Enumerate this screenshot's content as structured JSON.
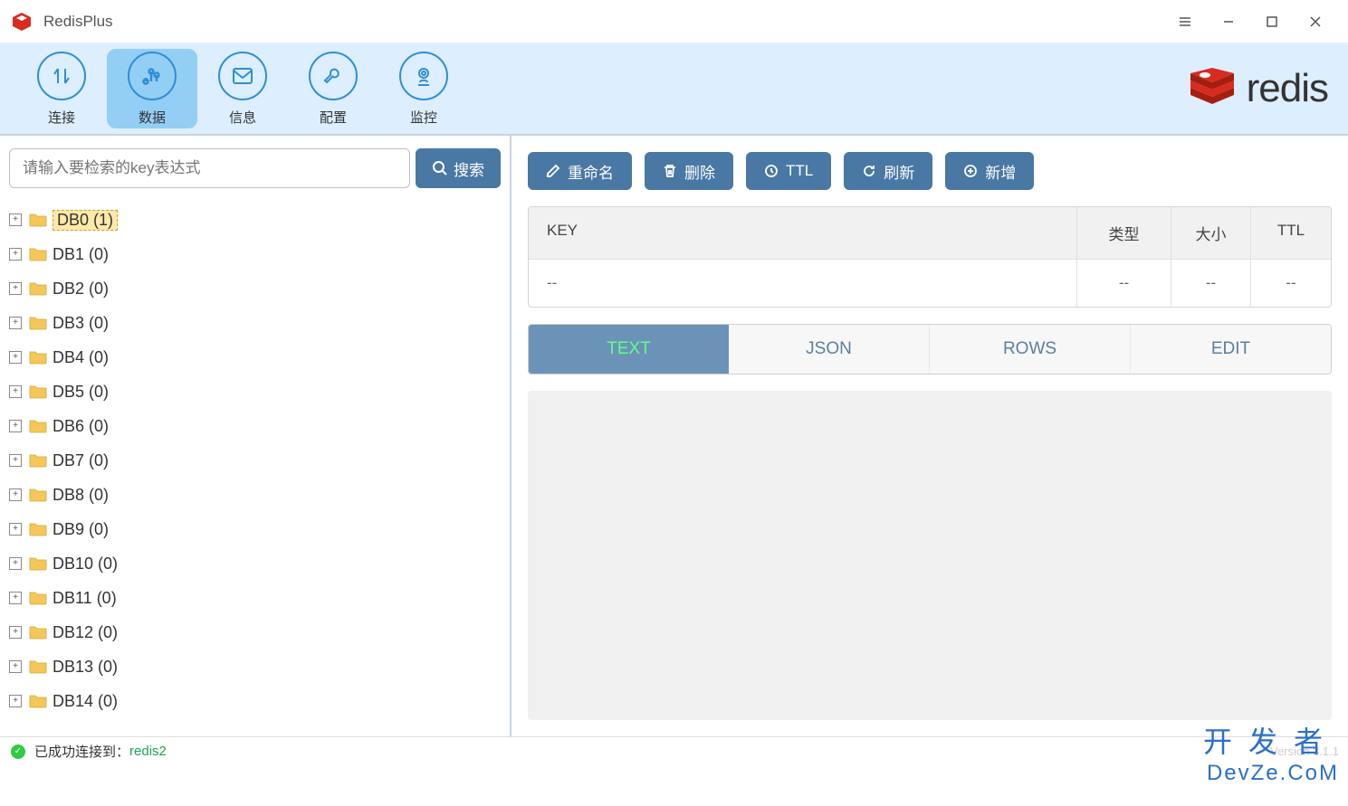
{
  "titlebar": {
    "app_name": "RedisPlus"
  },
  "toolbar": {
    "items": [
      {
        "label": "连接",
        "icon": "arrows"
      },
      {
        "label": "数据",
        "icon": "chart"
      },
      {
        "label": "信息",
        "icon": "mail"
      },
      {
        "label": "配置",
        "icon": "wrench"
      },
      {
        "label": "监控",
        "icon": "camera"
      }
    ],
    "active_index": 1,
    "logo_text": "redis"
  },
  "search": {
    "placeholder": "请输入要检索的key表达式",
    "button": "搜索"
  },
  "tree": {
    "items": [
      {
        "label": "DB0 (1)",
        "selected": true
      },
      {
        "label": "DB1 (0)"
      },
      {
        "label": "DB2 (0)"
      },
      {
        "label": "DB3 (0)"
      },
      {
        "label": "DB4 (0)"
      },
      {
        "label": "DB5 (0)"
      },
      {
        "label": "DB6 (0)"
      },
      {
        "label": "DB7 (0)"
      },
      {
        "label": "DB8 (0)"
      },
      {
        "label": "DB9 (0)"
      },
      {
        "label": "DB10 (0)"
      },
      {
        "label": "DB11 (0)"
      },
      {
        "label": "DB12 (0)"
      },
      {
        "label": "DB13 (0)"
      },
      {
        "label": "DB14 (0)"
      }
    ]
  },
  "actions": {
    "rename": "重命名",
    "delete": "删除",
    "ttl": "TTL",
    "refresh": "刷新",
    "add": "新增"
  },
  "keytable": {
    "headers": {
      "key": "KEY",
      "type": "类型",
      "size": "大小",
      "ttl": "TTL"
    },
    "row": {
      "key": "--",
      "type": "--",
      "size": "--",
      "ttl": "--"
    }
  },
  "viewtabs": [
    "TEXT",
    "JSON",
    "ROWS",
    "EDIT"
  ],
  "viewtab_active": 0,
  "statusbar": {
    "text": "已成功连接到：",
    "conn_name": "redis2",
    "version": "Version 3.1.1"
  },
  "watermark": {
    "cn": "开发者",
    "en": "DevZe.CoM"
  }
}
